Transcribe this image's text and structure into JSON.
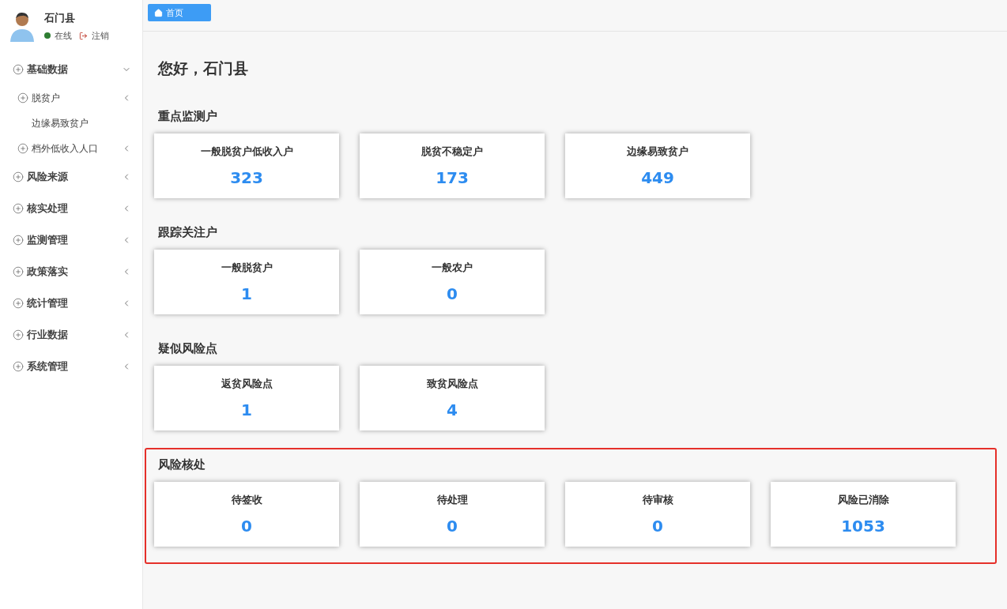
{
  "user": {
    "name": "石门县",
    "status": "在线",
    "online": true,
    "logout": "注销"
  },
  "sidebar": {
    "items": [
      {
        "label": "基础数据",
        "expanded": true,
        "children": [
          {
            "label": "脱贫户",
            "expanded": false
          },
          {
            "label": "边缘易致贫户"
          },
          {
            "label": "档外低收入人口",
            "expanded": false
          }
        ]
      },
      {
        "label": "风险来源",
        "expanded": false
      },
      {
        "label": "核实处理",
        "expanded": false
      },
      {
        "label": "监测管理",
        "expanded": false
      },
      {
        "label": "政策落实",
        "expanded": false
      },
      {
        "label": "统计管理",
        "expanded": false
      },
      {
        "label": "行业数据",
        "expanded": false
      },
      {
        "label": "系统管理",
        "expanded": false
      }
    ]
  },
  "tabs": [
    {
      "label": "首页",
      "selected": true
    }
  ],
  "greeting": "您好，石门县",
  "sections": [
    {
      "title": "重点监测户",
      "highlighted": false,
      "cards": [
        {
          "label": "一般脱贫户低收入户",
          "value": "323"
        },
        {
          "label": "脱贫不稳定户",
          "value": "173"
        },
        {
          "label": "边缘易致贫户",
          "value": "449"
        }
      ]
    },
    {
      "title": "跟踪关注户",
      "highlighted": false,
      "cards": [
        {
          "label": "一般脱贫户",
          "value": "1"
        },
        {
          "label": "一般农户",
          "value": "0"
        }
      ]
    },
    {
      "title": "疑似风险点",
      "highlighted": false,
      "cards": [
        {
          "label": "返贫风险点",
          "value": "1"
        },
        {
          "label": "致贫风险点",
          "value": "4"
        }
      ]
    },
    {
      "title": "风险核处",
      "highlighted": true,
      "cards": [
        {
          "label": "待签收",
          "value": "0"
        },
        {
          "label": "待处理",
          "value": "0"
        },
        {
          "label": "待审核",
          "value": "0"
        },
        {
          "label": "风险已消除",
          "value": "1053"
        }
      ]
    }
  ]
}
